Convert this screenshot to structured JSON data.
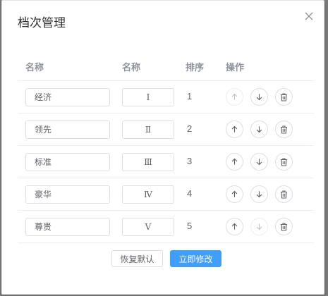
{
  "dialog": {
    "title": "档次管理"
  },
  "table": {
    "headers": {
      "name": "名称",
      "code": "名称",
      "order": "排序",
      "actions": "操作"
    },
    "rows": [
      {
        "name": "经济",
        "code": "Ⅰ",
        "order": "1",
        "up_disabled": true,
        "down_disabled": false
      },
      {
        "name": "领先",
        "code": "Ⅱ",
        "order": "2",
        "up_disabled": false,
        "down_disabled": false
      },
      {
        "name": "标准",
        "code": "Ⅲ",
        "order": "3",
        "up_disabled": false,
        "down_disabled": false
      },
      {
        "name": "豪华",
        "code": "Ⅳ",
        "order": "4",
        "up_disabled": false,
        "down_disabled": false
      },
      {
        "name": "尊贵",
        "code": "Ⅴ",
        "order": "5",
        "up_disabled": false,
        "down_disabled": true
      }
    ]
  },
  "footer": {
    "reset_label": "恢复默认",
    "save_label": "立即修改"
  },
  "colors": {
    "primary": "#409eff",
    "border": "#dcdfe6",
    "header_text": "#909399",
    "body_text": "#606266"
  },
  "icons": {
    "close": "close-icon",
    "up": "arrow-up-icon",
    "down": "arrow-down-icon",
    "delete": "trash-icon"
  }
}
